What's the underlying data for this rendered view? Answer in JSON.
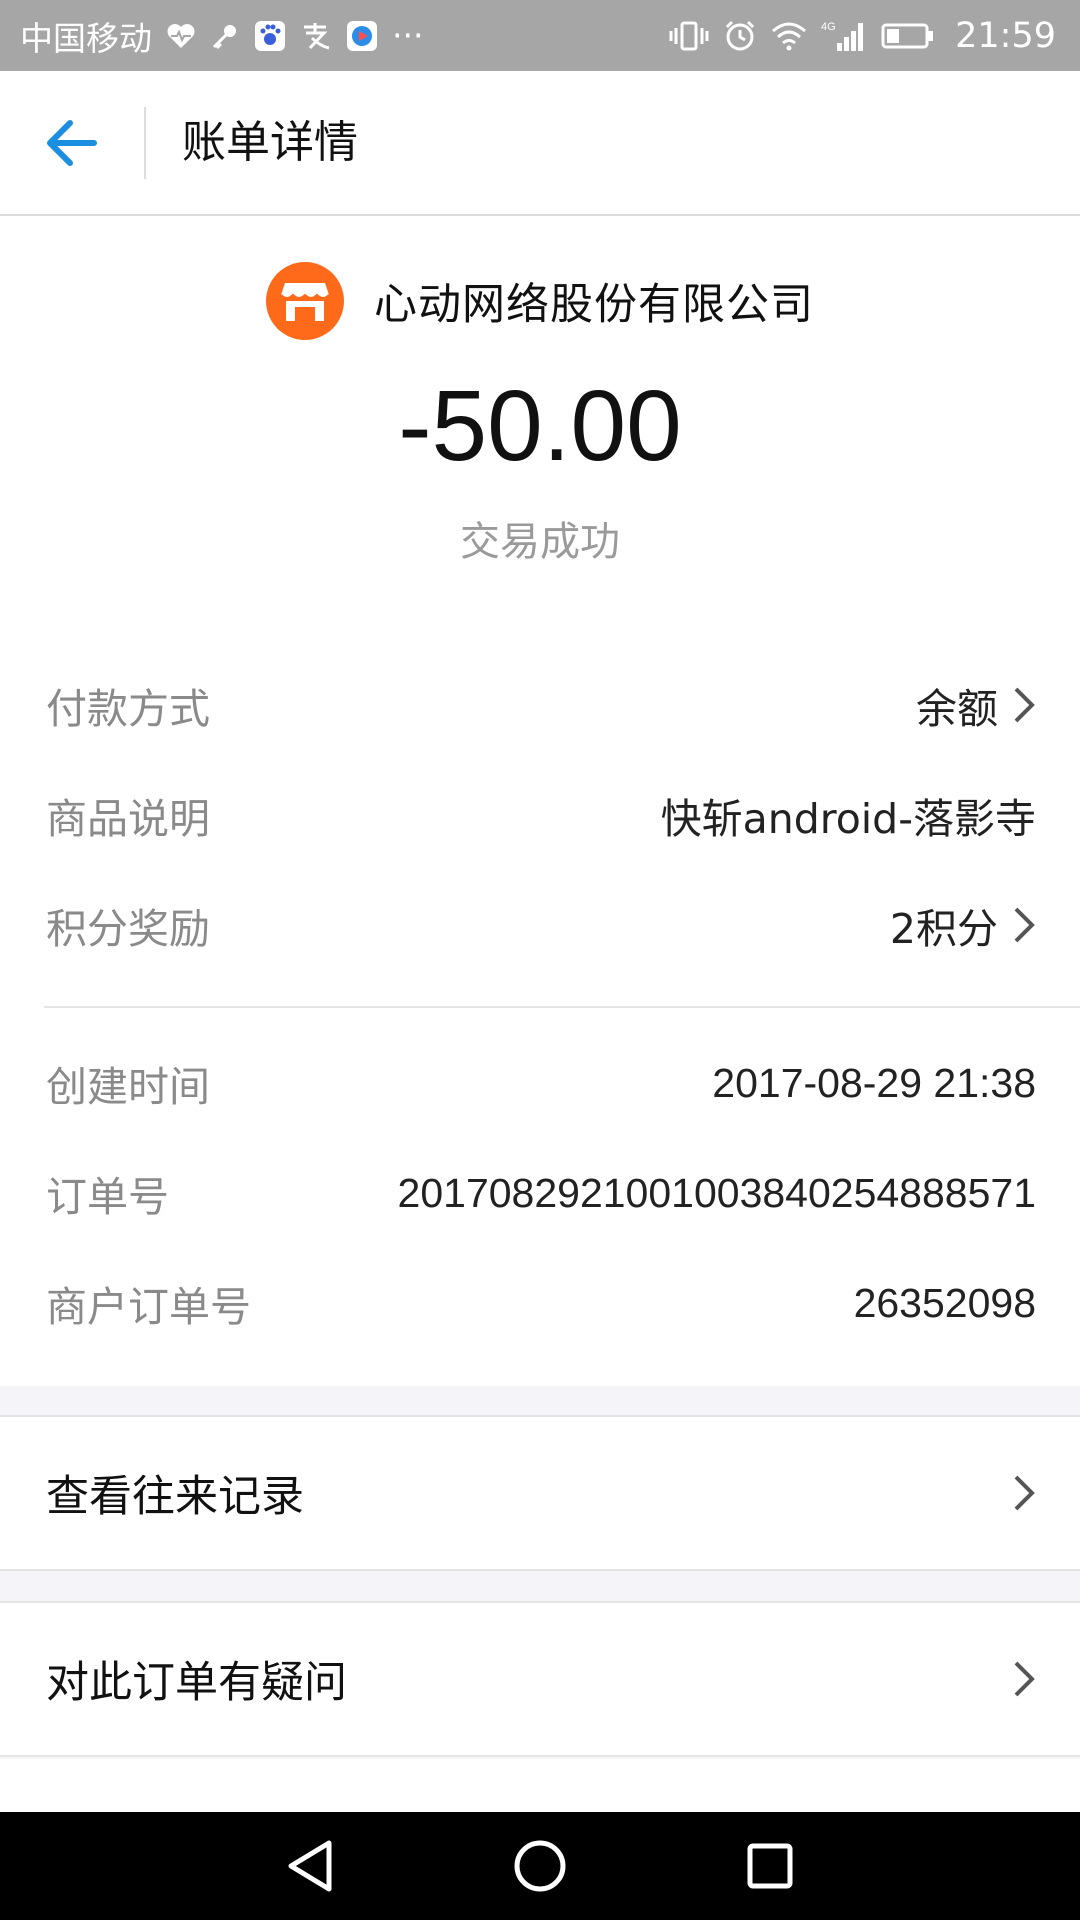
{
  "status_bar": {
    "carrier": "中国移动",
    "overflow": "···",
    "network": "4G",
    "time": "21:59",
    "icons": [
      "heart-pulse-icon",
      "key-icon",
      "baidu-icon",
      "alipay-icon",
      "play-icon",
      "vibrate-icon",
      "alarm-icon",
      "wifi-icon",
      "signal-icon",
      "battery-icon"
    ]
  },
  "header": {
    "title": "账单详情",
    "back_icon": "arrow-left-icon",
    "accent_color": "#1a8ee0"
  },
  "summary": {
    "merchant_name": "心动网络股份有限公司",
    "merchant_logo_icon": "shop-icon",
    "merchant_logo_color": "#ff6a1a",
    "amount": "-50.00",
    "status": "交易成功"
  },
  "details_top": [
    {
      "label": "付款方式",
      "value": "余额",
      "has_chevron": true
    },
    {
      "label": "商品说明",
      "value": "快斩android-落影寺",
      "has_chevron": false
    },
    {
      "label": "积分奖励",
      "value": "2积分",
      "has_chevron": true
    }
  ],
  "details_bottom": [
    {
      "label": "创建时间",
      "value": "2017-08-29 21:38"
    },
    {
      "label": "订单号",
      "value": "2017082921001003840254888571"
    },
    {
      "label": "商户订单号",
      "value": "26352098"
    }
  ],
  "actions": {
    "view_records": "查看往来记录",
    "order_question": "对此订单有疑问"
  },
  "nav_bar": {
    "icons": [
      "nav-back-icon",
      "nav-home-icon",
      "nav-recents-icon"
    ]
  }
}
